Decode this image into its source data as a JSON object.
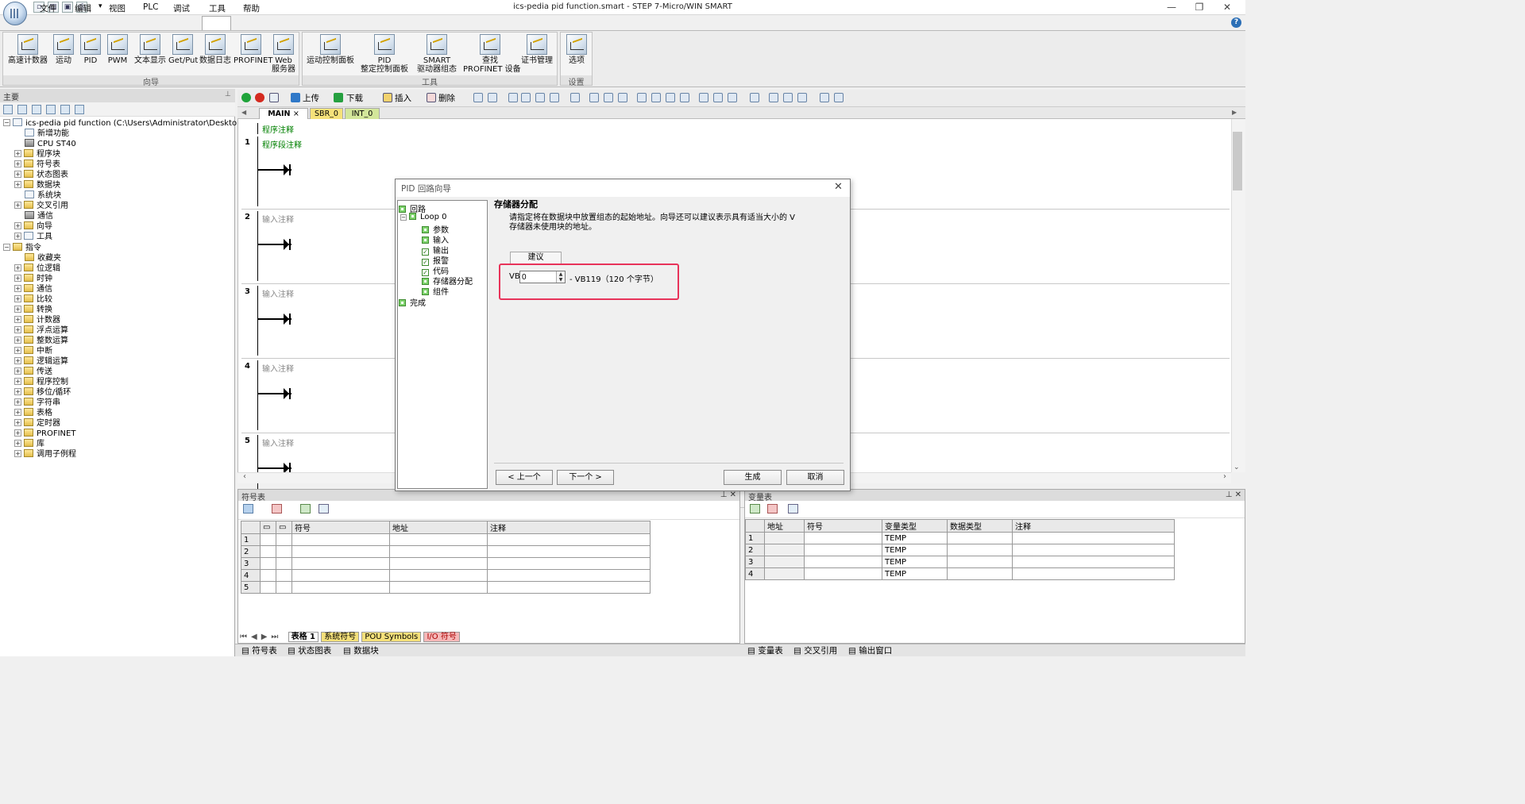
{
  "window": {
    "title": "ics-pedia pid function.smart - STEP 7-Micro/WIN SMART",
    "controls": [
      "—",
      "❐",
      "✕"
    ]
  },
  "quick_access": [
    "▫",
    "📂",
    "💾",
    "🖨",
    "▾"
  ],
  "menu": [
    "文件",
    "编辑",
    "视图",
    "PLC",
    "调试",
    "工具",
    "帮助"
  ],
  "help_label": "?",
  "ribbon": {
    "groups": [
      {
        "label": "向导",
        "buttons": [
          "高速计数器",
          "运动",
          "PID",
          "PWM",
          "文本显示",
          "Get/Put",
          "数据日志",
          "PROFINET",
          "Web\n服务器"
        ]
      },
      {
        "label": "工具",
        "buttons": [
          "运动控制面板",
          "PID\n整定控制面板",
          "SMART\n驱动器组态",
          "查找\nPROFINET 设备",
          "证书管理"
        ]
      },
      {
        "label": "设置",
        "buttons": [
          "选项"
        ]
      }
    ]
  },
  "left_panel": {
    "title": "主要",
    "pin": "⊥",
    "project_root": "ics-pedia pid function (C:\\Users\\Administrator\\Desktop\\PID)",
    "project_items": [
      "新增功能",
      "CPU ST40",
      "程序块",
      "符号表",
      "状态图表",
      "数据块",
      "系统块",
      "交叉引用",
      "通信",
      "向导",
      "工具"
    ],
    "instructions_root": "指令",
    "instruction_items": [
      "收藏夹",
      "位逻辑",
      "时钟",
      "通信",
      "比较",
      "转换",
      "计数器",
      "浮点运算",
      "整数运算",
      "中断",
      "逻辑运算",
      "传送",
      "程序控制",
      "移位/循环",
      "字符串",
      "表格",
      "定时器",
      "PROFINET",
      "库",
      "调用子例程"
    ]
  },
  "toolbar": {
    "upload": "上传",
    "download": "下载",
    "insert": "插入",
    "delete": "删除"
  },
  "editor": {
    "tabs": [
      "MAIN",
      "SBR_0",
      "INT_0"
    ],
    "tab_close": "×",
    "program_comment": "程序注释",
    "networks": [
      {
        "num": "1",
        "comment": "程序段注释"
      },
      {
        "num": "2",
        "comment": "输入注释"
      },
      {
        "num": "3",
        "comment": "输入注释"
      },
      {
        "num": "4",
        "comment": "输入注释"
      },
      {
        "num": "5",
        "comment": "输入注释"
      }
    ]
  },
  "symbol_table": {
    "title": "符号表",
    "headers": [
      "符号",
      "地址",
      "注释"
    ],
    "rows": [
      "1",
      "2",
      "3",
      "4",
      "5"
    ],
    "sheet_tabs": [
      "表格 1",
      "系统符号",
      "POU Symbols",
      "I/O 符号"
    ]
  },
  "variable_table": {
    "title": "变量表",
    "headers": [
      "地址",
      "符号",
      "变量类型",
      "数据类型",
      "注释"
    ],
    "rows": [
      {
        "n": "1",
        "type": "TEMP"
      },
      {
        "n": "2",
        "type": "TEMP"
      },
      {
        "n": "3",
        "type": "TEMP"
      },
      {
        "n": "4",
        "type": "TEMP"
      }
    ]
  },
  "statusbar": {
    "left": [
      "符号表",
      "状态图表",
      "数据块"
    ],
    "right": [
      "变量表",
      "交叉引用",
      "输出窗口"
    ]
  },
  "dialog": {
    "title": "PID 回路向导",
    "close": "✕",
    "tree": {
      "loop_root": "回路",
      "loop0": "Loop 0",
      "children": [
        "参数",
        "输入",
        "输出",
        "报警",
        "代码",
        "存储器分配",
        "组件"
      ],
      "finish": "完成"
    },
    "section_title": "存储器分配",
    "description": "请指定将在数据块中放置组态的起始地址。向导还可以建议表示具有适当大小的 V 存储器未使用块的地址。",
    "suggest_button": "建议",
    "vb_label": "VB",
    "vb_value": "0",
    "vb_range": "- VB119（120 个字节）",
    "buttons": {
      "prev": "< 上一个",
      "next": "下一个 >",
      "generate": "生成",
      "cancel": "取消"
    }
  },
  "colors": {
    "highlight": "#e8335a",
    "ribbon_bg": "#ececec",
    "comment_green": "#008000",
    "tab_yellow": "#f6e27a"
  }
}
